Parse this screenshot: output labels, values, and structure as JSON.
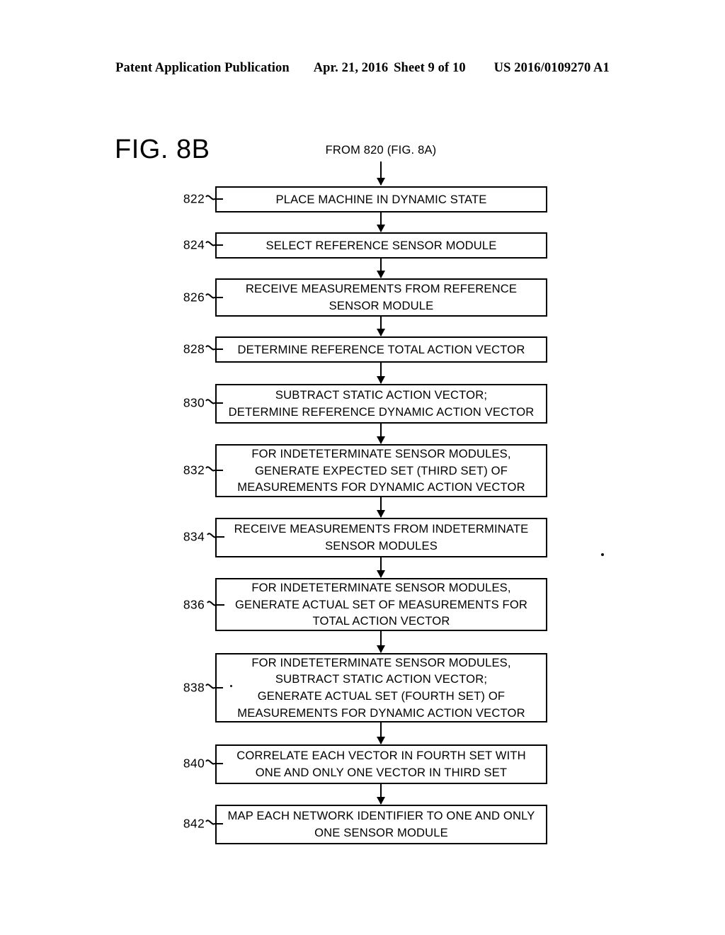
{
  "header": {
    "publication": "Patent Application Publication",
    "date": "Apr. 21, 2016",
    "sheet": "Sheet 9 of 10",
    "doc_number": "US 2016/0109270 A1"
  },
  "figure": {
    "title": "FIG. 8B",
    "entry_label": "FROM 820 (FIG. 8A)"
  },
  "flow": {
    "steps": [
      {
        "ref": "822",
        "text": "PLACE MACHINE IN DYNAMIC STATE"
      },
      {
        "ref": "824",
        "text": "SELECT REFERENCE SENSOR MODULE"
      },
      {
        "ref": "826",
        "text": "RECEIVE MEASUREMENTS FROM REFERENCE\nSENSOR MODULE"
      },
      {
        "ref": "828",
        "text": "DETERMINE REFERENCE TOTAL ACTION VECTOR"
      },
      {
        "ref": "830",
        "text": "SUBTRACT STATIC ACTION VECTOR;\nDETERMINE REFERENCE DYNAMIC ACTION VECTOR"
      },
      {
        "ref": "832",
        "text": "FOR INDETETERMINATE SENSOR MODULES,\nGENERATE EXPECTED SET (THIRD SET) OF\nMEASUREMENTS  FOR DYNAMIC ACTION VECTOR"
      },
      {
        "ref": "834",
        "text": "RECEIVE MEASUREMENTS FROM INDETERMINATE\nSENSOR MODULES"
      },
      {
        "ref": "836",
        "text": "FOR INDETETERMINATE SENSOR MODULES,\nGENERATE ACTUAL SET OF MEASUREMENTS  FOR\nTOTAL ACTION VECTOR"
      },
      {
        "ref": "838",
        "text": "FOR INDETETERMINATE SENSOR MODULES,\nSUBTRACT STATIC ACTION VECTOR;\nGENERATE ACTUAL SET (FOURTH SET) OF\nMEASUREMENTS  FOR DYNAMIC ACTION VECTOR"
      },
      {
        "ref": "840",
        "text": "CORRELATE EACH VECTOR IN FOURTH SET WITH\nONE AND ONLY ONE VECTOR IN THIRD SET"
      },
      {
        "ref": "842",
        "text": "MAP EACH NETWORK IDENTIFIER TO ONE AND ONLY\nONE SENSOR MODULE"
      }
    ]
  },
  "colors": {
    "ink": "#000000",
    "paper": "#ffffff"
  }
}
